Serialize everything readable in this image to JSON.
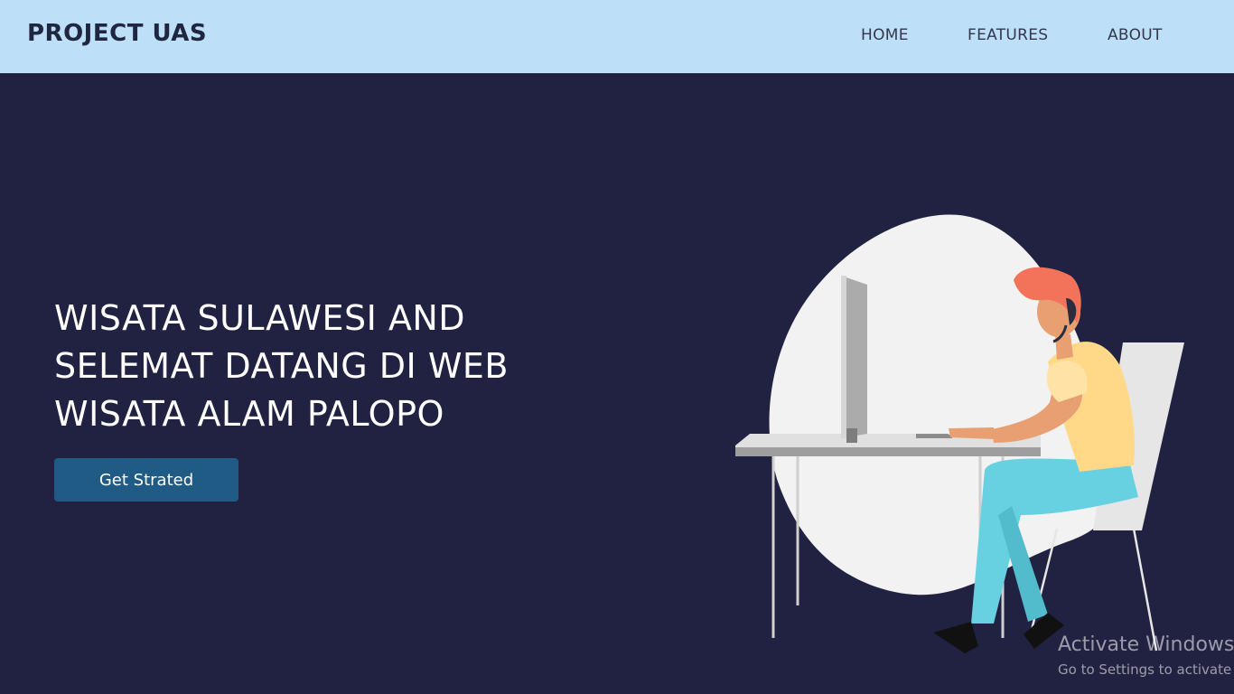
{
  "navbar": {
    "brand": "PROJECT UAS",
    "links": [
      {
        "label": "HOME"
      },
      {
        "label": "FEATURES"
      },
      {
        "label": "ABOUT"
      }
    ],
    "background_color": "#bde0f8"
  },
  "hero": {
    "title_lines": [
      "WISATA SULAWESI AND",
      "SELEMAT DATANG DI WEB",
      "WISATA ALAM PALOPO"
    ],
    "cta_label": "Get Strated",
    "cta_color": "#1f5b85",
    "background_color": "#212142",
    "illustration": "person-at-computer-illustration"
  },
  "watermark": {
    "title": "Activate Windows",
    "subtitle": "Go to Settings to activate Windows."
  }
}
